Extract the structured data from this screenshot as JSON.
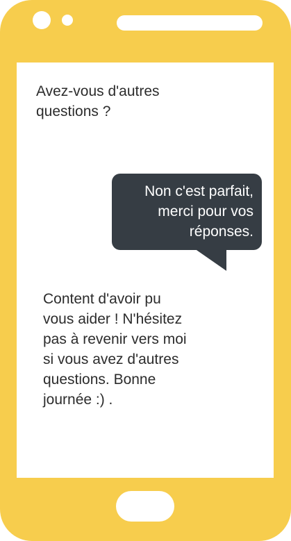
{
  "messages": {
    "bot_question": "Avez-vous d'autres questions ?",
    "user_reply": "Non c'est parfait,\nmerci pour vos\nréponses.",
    "bot_closing": "Content d'avoir pu\nvous aider ! N'hésitez\npas à revenir vers moi\nsi vous avez d'autres\nquestions. Bonne\njournée :) ."
  },
  "colors": {
    "phone_body": "#f7cd4d",
    "screen": "#ffffff",
    "user_bubble": "#363d44",
    "text_dark": "#2c2c2c",
    "text_light": "#ffffff"
  }
}
